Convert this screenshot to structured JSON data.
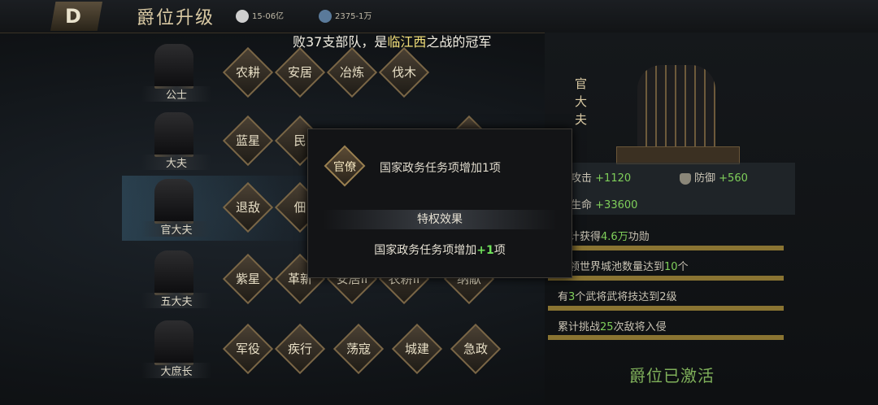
{
  "header": {
    "back_label": "D",
    "title": "爵位升级",
    "silver": "15-06亿",
    "gold": "2375-1万"
  },
  "news": {
    "pre": "败37支部队，是",
    "place": "临江西",
    "post": "之战的冠军"
  },
  "ranks": [
    {
      "name": "公士",
      "perks": [
        "农耕",
        "安居",
        "冶炼",
        "伐木"
      ]
    },
    {
      "name": "大夫",
      "perks": [
        "蓝星",
        "民",
        "",
        "",
        ""
      ]
    },
    {
      "name": "官大夫",
      "perks": [
        "退敌",
        "佃"
      ]
    },
    {
      "name": "五大夫",
      "perks": [
        "紫星",
        "革新",
        "安居II",
        "农耕II",
        "纳献"
      ]
    },
    {
      "name": "大庶长",
      "perks": [
        "军役",
        "疾行",
        "荡寇",
        "城建",
        "急政"
      ]
    }
  ],
  "detail": {
    "rank_name": "官大夫",
    "attack_label": "攻击",
    "attack_value": "+1120",
    "defense_label": "防御",
    "defense_value": "+560",
    "hp_label": "生命",
    "hp_value": "+33600",
    "conditions": [
      {
        "pre": "计获得",
        "num": "4.6万",
        "post": "功勋"
      },
      {
        "pre": "领世界城池数量达到",
        "num": "10",
        "post": "个"
      },
      {
        "pre": "有",
        "num": "3",
        "post": "个武将武将技达到2级"
      },
      {
        "pre": "累计挑战",
        "num": "25",
        "post": "次敌将入侵"
      }
    ],
    "status": "爵位已激活"
  },
  "popup": {
    "badge": "官僚",
    "description": "国家政务任务项增加1项",
    "section_title": "特权效果",
    "effect_pre": "国家政务任务项增加",
    "effect_num": "+1",
    "effect_post": "项"
  },
  "colors": {
    "accent_green": "#7fcf5a",
    "gold": "#d9c9a3"
  }
}
